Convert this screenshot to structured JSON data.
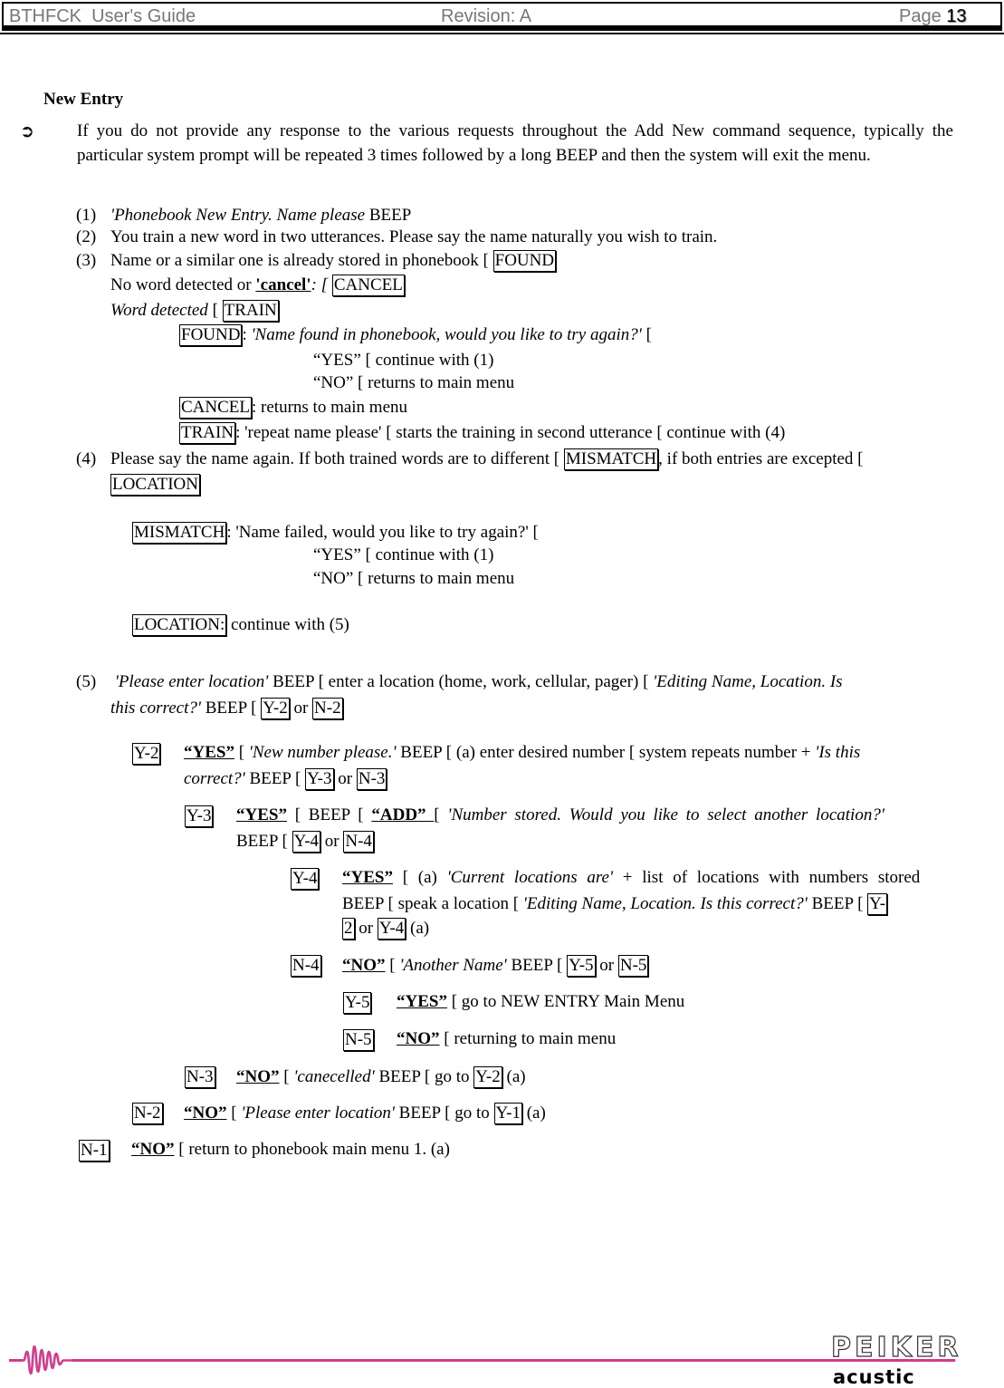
{
  "header": {
    "title": "BTHFCK  User's Guide",
    "revision": "Revision: A",
    "page_label": "Page ",
    "page_number": "13"
  },
  "section": {
    "title": "New Entry",
    "note_icon": "arrow-right-circle-icon",
    "note": "If you do not provide any response to the various requests throughout the Add New command sequence, typically the particular system prompt will be repeated 3 times followed by a long BEEP and then the system will exit the menu."
  },
  "steps": {
    "s1_num": "(1)",
    "s1_it": "'Phonebook New Entry. Name please",
    "s1_rest": " BEEP",
    "s2_num": "(2)",
    "s2_text": "You train a new word in two utterances. Please say the name naturally you wish to train.",
    "s3_num": "(3)",
    "s3_text": "Name or a similar one is already stored in phonebook [ ",
    "s3_box": "FOUND",
    "s3b_text": "No word detected or ",
    "s3b_bu": "'cancel'",
    "s3b_rest": ": [ ",
    "s3b_box": "CANCEL",
    "s3c_it": "Word detected",
    "s3c_rest": " [ ",
    "s3c_box": "TRAIN",
    "found_box": "FOUND",
    "found_it": "'Name found in phonebook, would you like to try again?'",
    "found_rest": " [",
    "found_yes": "“YES” [ continue with (1)",
    "found_no": "“NO” [ returns to main menu",
    "cancel_box": "CANCEL",
    "cancel_rest": ": returns to main menu",
    "train_box": "TRAIN",
    "train_rest": ": 'repeat name please' [ starts the training in second utterance [ continue with (4)",
    "s4_num": "(4)",
    "s4_text": "Please say the name again. If both trained words are to different [ ",
    "s4_box1": "MISMATCH",
    "s4_text2": ", if both entries are excepted [",
    "s4_box2": "LOCATION",
    "mismatch_box": "MISMATCH",
    "mismatch_rest": ": 'Name failed, would you like to try again?' [",
    "mismatch_yes": "“YES” [ continue with (1)",
    "mismatch_no": "“NO” [ returns to main menu",
    "location_box": "LOCATION:",
    "location_rest": " continue with (5)",
    "s5_num": "(5)",
    "s5_it1": "'Please enter location'",
    "s5_t1": " BEEP [ enter a location (home, work, cellular, pager) [ ",
    "s5_it2": "'Editing Name, Location.  Is",
    "s5_it3": "this correct?'",
    "s5_t2": " BEEP [ ",
    "s5_box1": "Y-2",
    "s5_or": " or ",
    "s5_box2": "N-2"
  },
  "branches": {
    "y2_box": "Y-2",
    "y2_bu": "“YES”",
    "y2_t1": " [ ",
    "y2_it1": "'New number please.'",
    "y2_t2": " BEEP [ (a) enter desired number [ system repeats number + ",
    "y2_it2": "'Is this",
    "y2_it3": "correct?'",
    "y2_t3": " BEEP [ ",
    "y2_b1": "Y-3",
    "y2_or": " or ",
    "y2_b2": "N-3",
    "y3_box": "Y-3",
    "y3_bu": "“YES”",
    "y3_t1": " [ BEEP [ ",
    "y3_bu2": "“ADD” ",
    "y3_t2": " [ ",
    "y3_it": "'Number stored.  Would you like to select another location?'",
    "y3_t3": "BEEP [ ",
    "y3_b1": "Y-4",
    "y3_or": " or ",
    "y3_b2": "N-4",
    "y4_box": "Y-4",
    "y4_bu": "“YES”",
    "y4_t1": " [ (a) ",
    "y4_it1": "'Current locations are'",
    "y4_t2": " + list of locations with numbers stored",
    "y4_t3": "BEEP [ speak a location [ ",
    "y4_it2": "'Editing Name, Location. Is this correct?'",
    "y4_t4": " BEEP [ ",
    "y4_b1a": "Y-",
    "y4_b1b": "2",
    "y4_or": " or ",
    "y4_b2": "Y-4",
    "y4_t5": " (a)",
    "n4_box": "N-4",
    "n4_bu": "“NO”",
    "n4_t1": " [ ",
    "n4_it": "'Another Name'",
    "n4_t2": " BEEP [ ",
    "n4_b1": "Y-5",
    "n4_or": " or ",
    "n4_b2": "N-5",
    "y5_box": "Y-5",
    "y5_bu": "“YES”",
    "y5_t": " [ go to NEW ENTRY Main Menu",
    "n5_box": "N-5",
    "n5_bu": "“NO”",
    "n5_t": " [ returning to main menu",
    "n3_box": "N-3",
    "n3_bu": "“NO”",
    "n3_t1": " [ ",
    "n3_it": "'canecelled'",
    "n3_t2": " BEEP [ go to ",
    "n3_b": "Y-2",
    "n3_t3": " (a)",
    "n2_box": "N-2",
    "n2_bu": "“NO”",
    "n2_t1": " [ ",
    "n2_it": "'Please enter location'",
    "n2_t2": " BEEP [ go to ",
    "n2_b": "Y-1",
    "n2_t3": " (a)",
    "n1_box": "N-1",
    "n1_bu": "“NO”",
    "n1_t": " [ return to phonebook main menu 1. (a)"
  },
  "footer": {
    "brand": "PEIKER",
    "brand_sub": "acustic",
    "brand_color": "#d63a8f"
  }
}
